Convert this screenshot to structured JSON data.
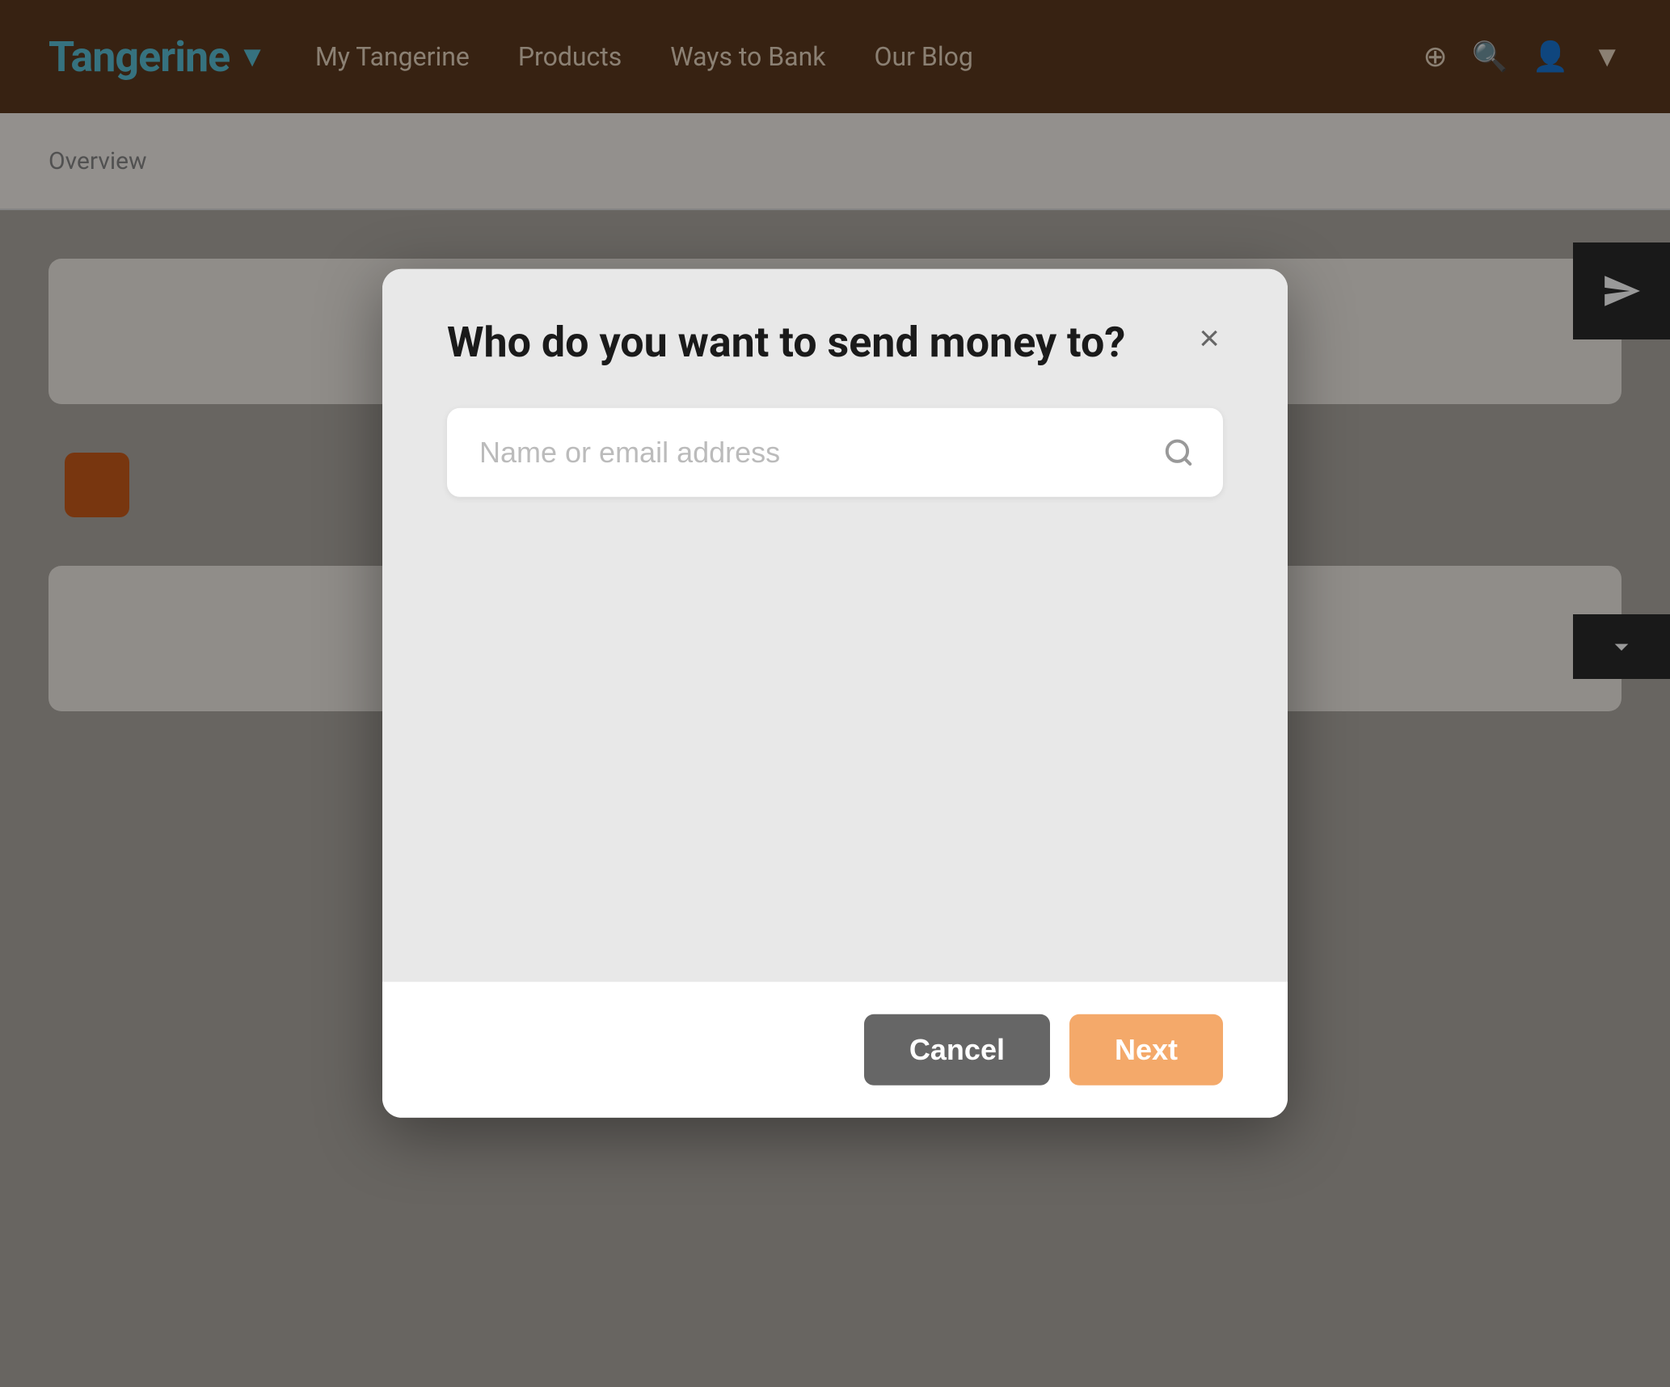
{
  "navbar": {
    "logo": "Tangerine",
    "logo_icon": "▼",
    "links": [
      {
        "label": "My Tangerine"
      },
      {
        "label": "Products"
      },
      {
        "label": "Ways to Bank"
      },
      {
        "label": "Our Blog"
      }
    ]
  },
  "bg_nav": {
    "items": [
      "Overview"
    ]
  },
  "modal": {
    "title": "Who do you want to send money to?",
    "close_label": "×",
    "search": {
      "placeholder": "Name or email address"
    },
    "footer": {
      "cancel_label": "Cancel",
      "next_label": "Next"
    }
  },
  "colors": {
    "brand_orange": "#f4a96a",
    "brand_dark": "#5c3a1e",
    "logo_teal": "#5bbfd4",
    "cancel_bg": "#666666"
  }
}
